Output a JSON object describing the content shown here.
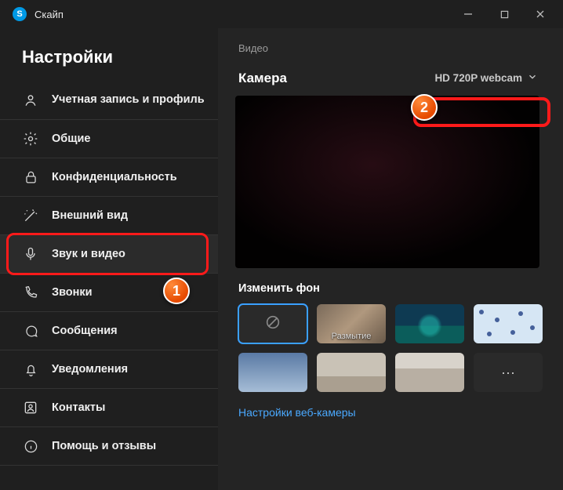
{
  "app": {
    "title": "Скайп",
    "logoLetter": "S"
  },
  "windowControls": {
    "minimize": "minimize",
    "maximize": "maximize",
    "close": "close"
  },
  "sidebar": {
    "title": "Настройки",
    "items": [
      {
        "label": "Учетная запись и профиль"
      },
      {
        "label": "Общие"
      },
      {
        "label": "Конфиденциальность"
      },
      {
        "label": "Внешний вид"
      },
      {
        "label": "Звук и видео"
      },
      {
        "label": "Звонки"
      },
      {
        "label": "Сообщения"
      },
      {
        "label": "Уведомления"
      },
      {
        "label": "Контакты"
      },
      {
        "label": "Помощь и отзывы"
      }
    ]
  },
  "main": {
    "sectionLabel": "Видео",
    "cameraTitle": "Камера",
    "cameraSelected": "HD 720P webcam",
    "backgroundTitle": "Изменить фон",
    "thumbs": {
      "blurLabel": "Размытие",
      "moreLabel": "···"
    },
    "webcamSettingsLink": "Настройки веб-камеры"
  },
  "annotations": {
    "badge1": "1",
    "badge2": "2"
  }
}
